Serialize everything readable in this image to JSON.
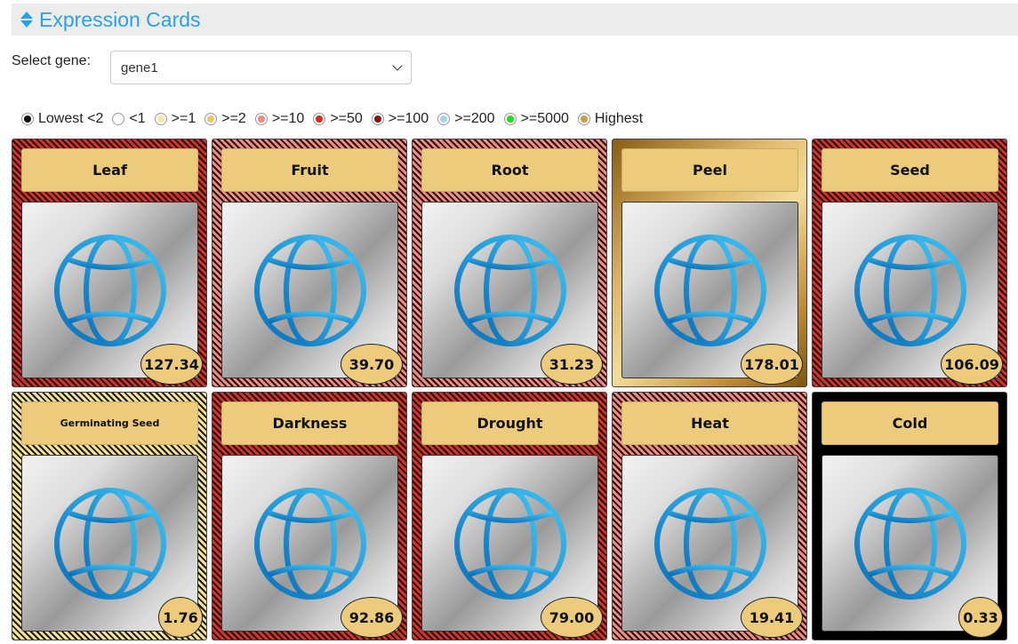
{
  "header": {
    "title": "Expression Cards",
    "icon": "sort-icon"
  },
  "gene_select": {
    "label": "Select gene:",
    "value": "gene1"
  },
  "legend": [
    {
      "label": "Lowest <2",
      "color": "#111111"
    },
    {
      "label": "<1",
      "color": "#ffffff"
    },
    {
      "label": ">=1",
      "color": "#f6e9a6"
    },
    {
      "label": ">=2",
      "color": "#f6c460"
    },
    {
      "label": ">=10",
      "color": "#ee8a80"
    },
    {
      "label": ">=50",
      "color": "#d42a22"
    },
    {
      "label": ">=100",
      "color": "#8e1010"
    },
    {
      "label": ">=200",
      "color": "#9ed8f0"
    },
    {
      "label": ">=5000",
      "color": "#22dd22"
    },
    {
      "label": "Highest",
      "color": "#c9a04a"
    }
  ],
  "cards": [
    {
      "title": "Leaf",
      "value": "127.34",
      "level": ">=100"
    },
    {
      "title": "Fruit",
      "value": "39.70",
      "level": ">=10"
    },
    {
      "title": "Root",
      "value": "31.23",
      "level": ">=10"
    },
    {
      "title": "Peel",
      "value": "178.01",
      "level": "Highest"
    },
    {
      "title": "Seed",
      "value": "106.09",
      "level": ">=100"
    },
    {
      "title": "Germinating Seed",
      "value": "1.76",
      "level": ">=1"
    },
    {
      "title": "Darkness",
      "value": "92.86",
      "level": ">=50"
    },
    {
      "title": "Drought",
      "value": "79.00",
      "level": ">=50"
    },
    {
      "title": "Heat",
      "value": "19.41",
      "level": ">=10"
    },
    {
      "title": "Cold",
      "value": "0.33",
      "level": "Lowest <2"
    }
  ]
}
